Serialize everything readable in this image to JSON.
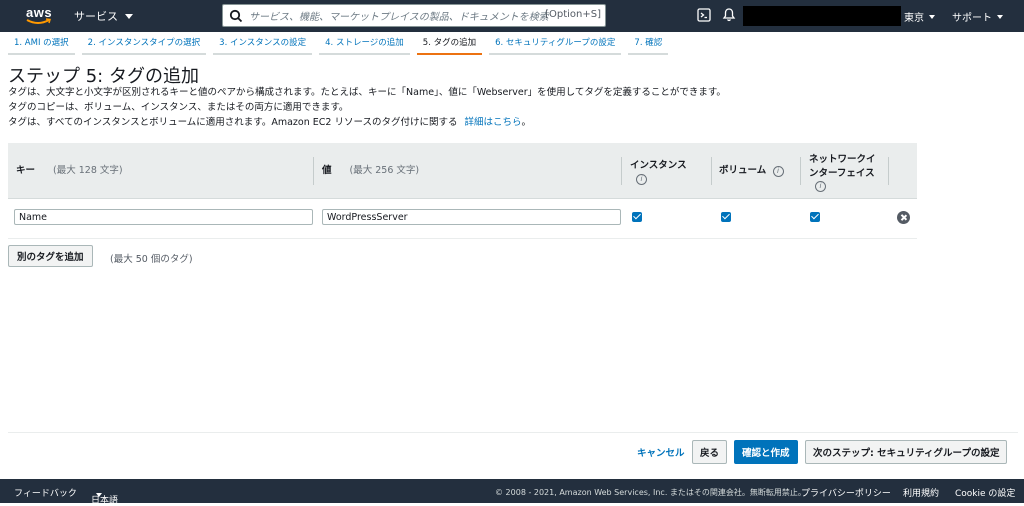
{
  "topnav": {
    "logo_text": "aws",
    "services_label": "サービス",
    "search_placeholder": "サービス、機能、マーケットプレイスの製品、ドキュメントを検索",
    "search_shortcut": "[Option+S]",
    "region_label": "東京",
    "support_label": "サポート"
  },
  "steps": [
    {
      "label": "1. AMI の選択"
    },
    {
      "label": "2. インスタンスタイプの選択"
    },
    {
      "label": "3. インスタンスの設定"
    },
    {
      "label": "4. ストレージの追加"
    },
    {
      "label": "5. タグの追加"
    },
    {
      "label": "6. セキュリティグループの設定"
    },
    {
      "label": "7. 確認"
    }
  ],
  "main": {
    "title": "ステップ 5: タグの追加",
    "desc1": "タグは、大文字と小文字が区別されるキーと値のペアから構成されます。たとえば、キーに「Name」、値に「Webserver」を使用してタグを定義することができます。",
    "desc2": "タグのコピーは、ボリューム、インスタンス、またはその両方に適用できます。",
    "desc3_prefix": "タグは、すべてのインスタンスとボリュームに適用されます。Amazon EC2 リソースのタグ付けに関する",
    "desc3_link": "詳細はこちら",
    "desc3_suffix": "。"
  },
  "table": {
    "headers": {
      "key": "キー",
      "key_hint": "(最大 128 文字)",
      "value": "値",
      "value_hint": "(最大 256 文字)",
      "instances_line1": "インスタンス",
      "volumes": "ボリューム",
      "eni_line1": "ネットワークイ",
      "eni_line2": "ンターフェイス"
    },
    "rows": [
      {
        "key": "Name",
        "value": "WordPressServer",
        "instances": true,
        "volumes": true,
        "eni": true
      }
    ]
  },
  "add_tag_label": "別のタグを追加",
  "max_tags_note": "(最大 50 個のタグ)",
  "actions": {
    "cancel": "キャンセル",
    "back": "戻る",
    "review": "確認と作成",
    "next": "次のステップ: セキュリティグループの設定"
  },
  "footer": {
    "feedback": "フィードバック",
    "language": "日本語",
    "copyright": "© 2008 - 2021, Amazon Web Services, Inc. またはその関連会社。無断転用禁止。",
    "privacy": "プライバシーポリシー",
    "terms": "利用規約",
    "cookie": "Cookie の設定"
  },
  "colors": {
    "nav_bg": "#232f3e",
    "link": "#0073bb",
    "active_step": "#ec7211",
    "primary_button": "#0073bb"
  }
}
